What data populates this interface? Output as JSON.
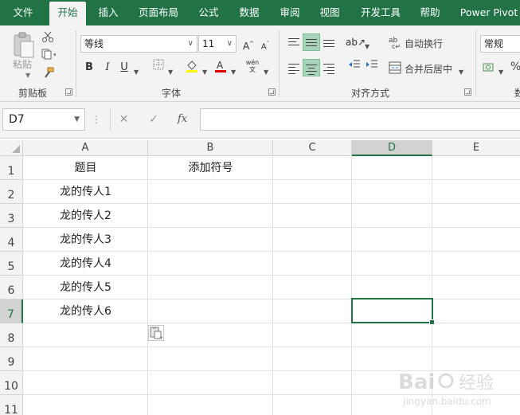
{
  "tabs": [
    {
      "label": "文件",
      "active": false
    },
    {
      "label": "开始",
      "active": true
    },
    {
      "label": "插入",
      "active": false
    },
    {
      "label": "页面布局",
      "active": false
    },
    {
      "label": "公式",
      "active": false
    },
    {
      "label": "数据",
      "active": false
    },
    {
      "label": "审阅",
      "active": false
    },
    {
      "label": "视图",
      "active": false
    },
    {
      "label": "开发工具",
      "active": false
    },
    {
      "label": "帮助",
      "active": false
    },
    {
      "label": "Power Pivot",
      "active": false
    }
  ],
  "ribbon": {
    "clipboard": {
      "label": "剪贴板",
      "paste_label": "粘贴"
    },
    "font": {
      "label": "字体",
      "font_name": "等线",
      "font_size": "11",
      "bold": "B",
      "italic": "I",
      "underline": "U",
      "phonetic": "wén\n文"
    },
    "alignment": {
      "label": "对齐方式",
      "wrap_text": "自动换行",
      "merge_center": "合并后居中"
    },
    "number": {
      "label": "数",
      "format": "常规",
      "percent": "%"
    }
  },
  "formula_bar": {
    "name_box": "D7",
    "formula": ""
  },
  "colors": {
    "accent": "#217346",
    "selected_button": "#a9d3b8"
  },
  "grid": {
    "columns": [
      "A",
      "B",
      "C",
      "D",
      "E"
    ],
    "active_column": "D",
    "rows": [
      "1",
      "2",
      "3",
      "4",
      "5",
      "6",
      "7",
      "8",
      "9",
      "10",
      "11"
    ],
    "active_row": "7",
    "cells": {
      "A1": "题目",
      "B1": "添加符号",
      "A2": "龙的传人1",
      "A3": "龙的传人2",
      "A4": "龙的传人3",
      "A5": "龙的传人4",
      "A6": "龙的传人5",
      "A7": "龙的传人6"
    }
  },
  "watermark": "Bai 经验 jingyan.baidu.com"
}
